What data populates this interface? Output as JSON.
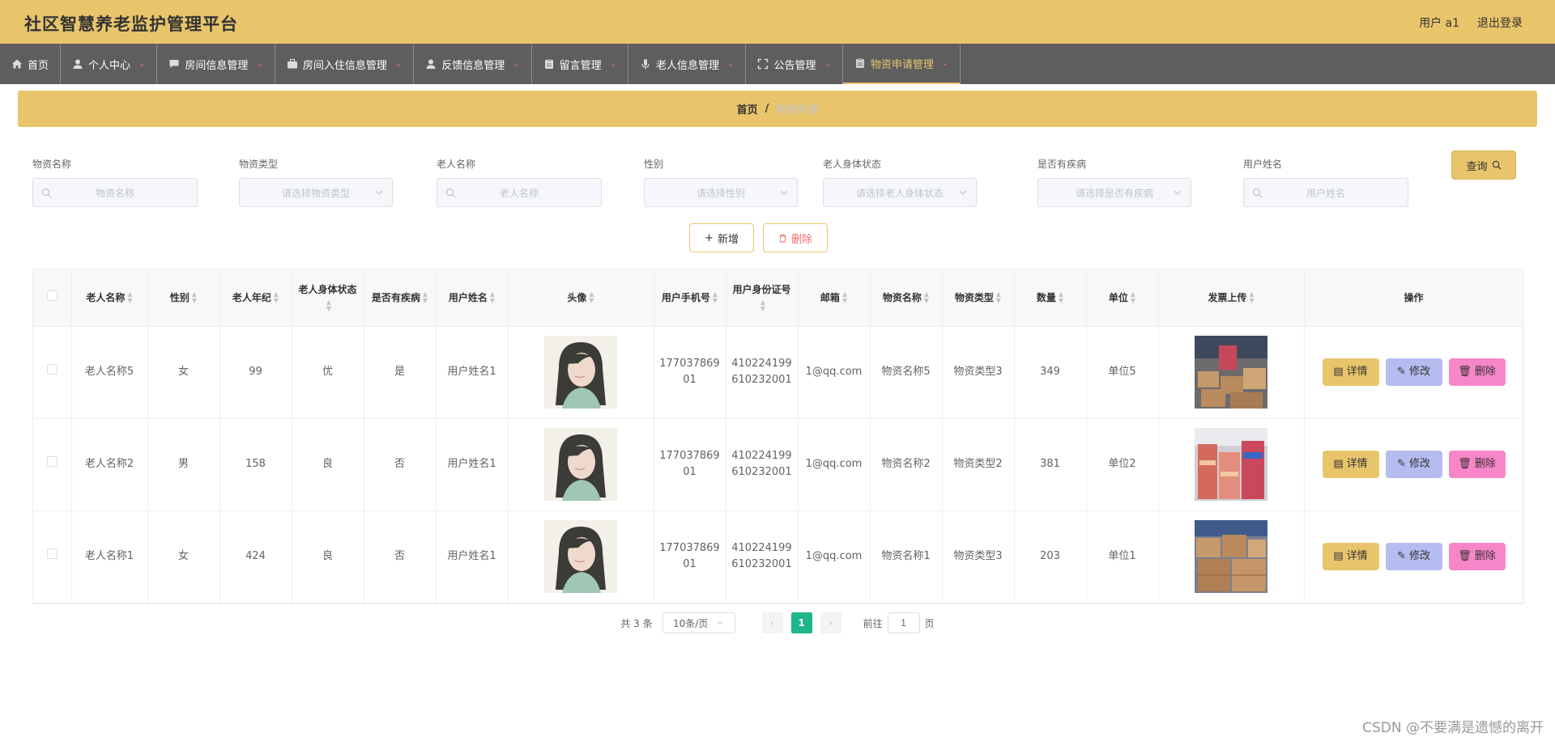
{
  "app": {
    "title": "社区智慧养老监护管理平台"
  },
  "header": {
    "user_label": "用户 a1",
    "logout_label": "退出登录"
  },
  "nav": [
    {
      "label": "首页",
      "icon": "home-icon",
      "has_dropdown": false
    },
    {
      "label": "个人中心",
      "icon": "user-icon",
      "has_dropdown": true
    },
    {
      "label": "房间信息管理",
      "icon": "chat-icon",
      "has_dropdown": true
    },
    {
      "label": "房间入住信息管理",
      "icon": "briefcase-icon",
      "has_dropdown": true
    },
    {
      "label": "反馈信息管理",
      "icon": "user-icon",
      "has_dropdown": true
    },
    {
      "label": "留言管理",
      "icon": "clipboard-icon",
      "has_dropdown": true
    },
    {
      "label": "老人信息管理",
      "icon": "microphone-icon",
      "has_dropdown": true
    },
    {
      "label": "公告管理",
      "icon": "fullscreen-icon",
      "has_dropdown": true
    },
    {
      "label": "物资申请管理",
      "icon": "clipboard-icon",
      "has_dropdown": true,
      "active": true
    }
  ],
  "breadcrumb": {
    "home": "首页",
    "separator": "/",
    "current": "物资申请"
  },
  "filters": {
    "material_name": {
      "label": "物资名称",
      "placeholder": "物资名称"
    },
    "material_type": {
      "label": "物资类型",
      "placeholder": "请选择物资类型"
    },
    "elder_name": {
      "label": "老人名称",
      "placeholder": "老人名称"
    },
    "gender": {
      "label": "性别",
      "placeholder": "请选择性别"
    },
    "health_status": {
      "label": "老人身体状态",
      "placeholder": "请选择老人身体状态"
    },
    "has_disease": {
      "label": "是否有疾病",
      "placeholder": "请选择是否有疾病"
    },
    "user_name": {
      "label": "用户姓名",
      "placeholder": "用户姓名"
    },
    "query_label": "查询"
  },
  "actions": {
    "add_label": "新增",
    "delete_label": "删除"
  },
  "table": {
    "headers": [
      "老人名称",
      "性别",
      "老人年纪",
      "老人身体状态",
      "是否有疾病",
      "用户姓名",
      "头像",
      "用户手机号",
      "用户身份证号",
      "邮箱",
      "物资名称",
      "物资类型",
      "数量",
      "单位",
      "发票上传",
      "操作"
    ],
    "rows": [
      {
        "elder_name": "老人名称5",
        "gender": "女",
        "age": "99",
        "health": "优",
        "disease": "是",
        "user_name": "用户姓名1",
        "phone": "17703786901",
        "id_card": "410224199610232001",
        "email": "1@qq.com",
        "material_name": "物资名称5",
        "material_type": "物资类型3",
        "quantity": "349",
        "unit": "单位5"
      },
      {
        "elder_name": "老人名称2",
        "gender": "男",
        "age": "158",
        "health": "良",
        "disease": "否",
        "user_name": "用户姓名1",
        "phone": "17703786901",
        "id_card": "410224199610232001",
        "email": "1@qq.com",
        "material_name": "物资名称2",
        "material_type": "物资类型2",
        "quantity": "381",
        "unit": "单位2"
      },
      {
        "elder_name": "老人名称1",
        "gender": "女",
        "age": "424",
        "health": "良",
        "disease": "否",
        "user_name": "用户姓名1",
        "phone": "17703786901",
        "id_card": "410224199610232001",
        "email": "1@qq.com",
        "material_name": "物资名称1",
        "material_type": "物资类型3",
        "quantity": "203",
        "unit": "单位1"
      }
    ],
    "row_actions": {
      "detail": "详情",
      "edit": "修改",
      "delete": "删除"
    }
  },
  "pagination": {
    "total_label": "共 3 条",
    "page_size": "10条/页",
    "current_page": "1",
    "goto_prefix": "前往",
    "goto_value": "1",
    "goto_suffix": "页"
  },
  "watermark": "CSDN @不要满是遗憾的离开",
  "colors": {
    "accent": "#e8c56b",
    "nav_bg": "#5e5e5e",
    "page_active": "#1fb68a",
    "edit_btn": "#b5bcef",
    "delete_btn": "#f786c8"
  }
}
